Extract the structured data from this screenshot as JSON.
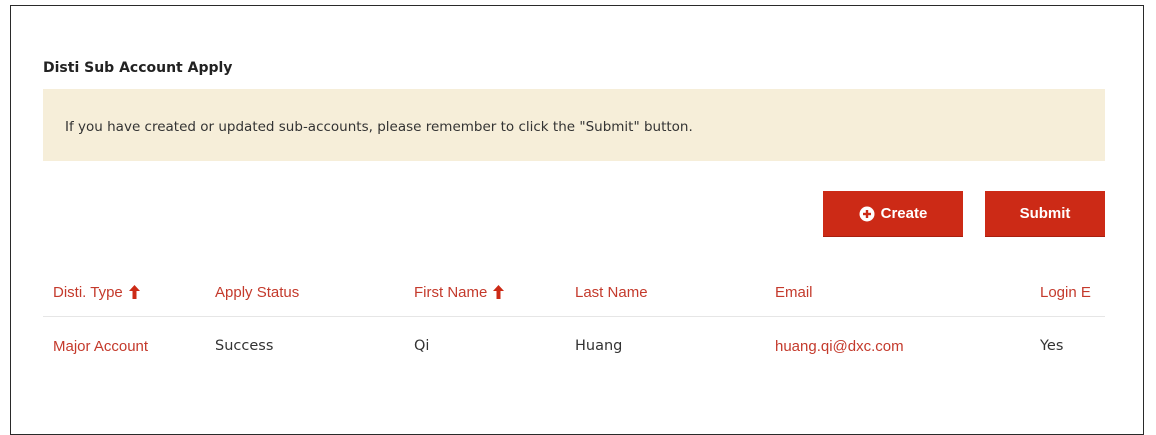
{
  "panel": {
    "title": "Disti Sub Account Apply",
    "notice": "If you have created or updated sub-accounts, please remember to click the \"Submit\" button."
  },
  "actions": {
    "create_label": "Create",
    "create_icon": "plus-circle-icon",
    "submit_label": "Submit"
  },
  "table": {
    "columns": [
      {
        "label": "Disti. Type",
        "sort_icon": "arrow-up-icon"
      },
      {
        "label": "Apply Status"
      },
      {
        "label": "First Name",
        "sort_icon": "arrow-up-icon"
      },
      {
        "label": "Last Name"
      },
      {
        "label": "Email"
      },
      {
        "label": "Login E"
      }
    ],
    "rows": [
      {
        "disti_type": "Major Account",
        "apply_status": "Success",
        "first_name": "Qi",
        "last_name": "Huang",
        "email": "huang.qi@dxc.com",
        "login_enabled": "Yes"
      }
    ]
  },
  "colors": {
    "accent": "#cc2a16",
    "link": "#c43a2c",
    "notice_bg": "#f6eed9"
  }
}
